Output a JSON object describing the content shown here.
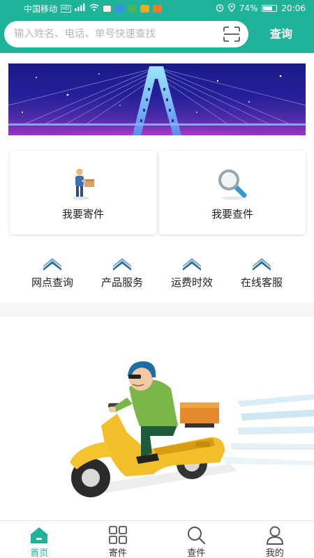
{
  "status_bar": {
    "carrier": "中国移动",
    "hd_badge": "HD",
    "network": "4G",
    "battery": "74%",
    "battery_level": 0.74,
    "time": "20:06"
  },
  "search": {
    "placeholder": "输入姓名、电话、单号快速查找",
    "value": "",
    "scan_icon": "scan-icon",
    "button_label": "查询"
  },
  "banner": {
    "icon": "bridge-illustration"
  },
  "cards": [
    {
      "label": "我要寄件",
      "icon": "courier-with-package-illustration"
    },
    {
      "label": "我要查件",
      "icon": "magnifier-illustration"
    }
  ],
  "quick_entries": [
    {
      "label": "网点查询",
      "icon": "chevron-up-icon"
    },
    {
      "label": "产品服务",
      "icon": "chevron-up-icon"
    },
    {
      "label": "运费时效",
      "icon": "chevron-up-icon"
    },
    {
      "label": "在线客服",
      "icon": "chevron-up-icon"
    }
  ],
  "hero": {
    "icon": "delivery-scooter-illustration"
  },
  "tabs": [
    {
      "label": "首页",
      "icon": "home-icon",
      "active": true
    },
    {
      "label": "寄件",
      "icon": "grid-icon",
      "active": false
    },
    {
      "label": "查件",
      "icon": "search-icon",
      "active": false
    },
    {
      "label": "我的",
      "icon": "user-icon",
      "active": false
    }
  ],
  "colors": {
    "primary": "#1fb49a",
    "chevron": "#2c6c98",
    "text": "#222222",
    "placeholder": "#b7b7b7"
  }
}
